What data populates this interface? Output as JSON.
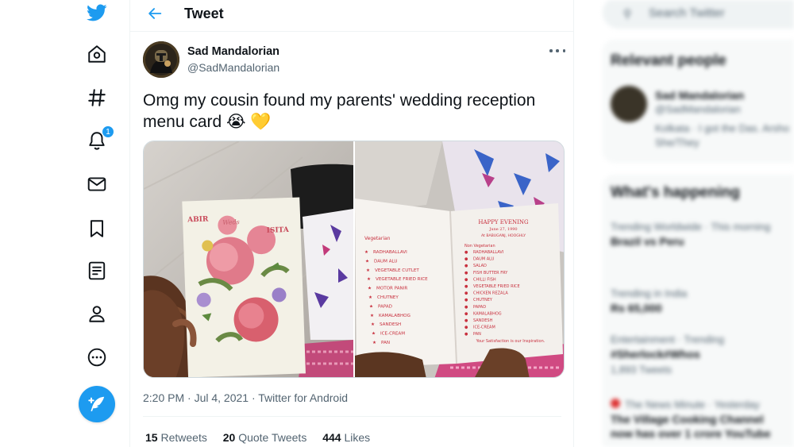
{
  "app": {
    "title": "Tweet",
    "brand_color": "#1d9bf0",
    "notification_count": "1"
  },
  "nav": {
    "items": [
      {
        "icon": "twitter-logo-icon"
      },
      {
        "icon": "home-icon"
      },
      {
        "icon": "explore-hashtag-icon"
      },
      {
        "icon": "notifications-bell-icon",
        "badge": "1"
      },
      {
        "icon": "messages-envelope-icon"
      },
      {
        "icon": "bookmarks-icon"
      },
      {
        "icon": "lists-icon"
      },
      {
        "icon": "profile-icon"
      },
      {
        "icon": "more-circle-icon"
      }
    ],
    "compose_icon": "compose-feather-icon"
  },
  "tweet": {
    "author_name": "Sad Mandalorian",
    "author_handle": "@SadMandalorian",
    "text": "Omg my cousin found my parents' wedding reception menu card 😭 💛",
    "meta": "2:20 PM · Jul 4, 2021 · Twitter for Android",
    "stats": {
      "retweets_count": "15",
      "retweets_label": "Retweets",
      "quotes_count": "20",
      "quotes_label": "Quote Tweets",
      "likes_count": "444",
      "likes_label": "Likes"
    },
    "card_front": {
      "name_left": "ABIR",
      "weds": "Weds",
      "name_right": "ISITA"
    },
    "card_inside": {
      "heading": "HAPPY EVENING",
      "date": "June 27, 1990",
      "place": "At BABUGANJ, HOOGHLY",
      "veg_title": "Vegetarian",
      "veg_items": [
        "RADHABALLAVI",
        "DAUM ALU",
        "VEGETABLE CUTLET",
        "VEGETABLE FRIED RICE",
        "MOTOR PANIR",
        "CHUTNEY",
        "PAPAD",
        "KAMALABHOG",
        "SANDESH",
        "ICE-CREAM",
        "PAN"
      ],
      "nonveg_title": "Non Vegetarian",
      "nonveg_items": [
        "RADHABALLAVI",
        "DAUM ALU",
        "SALAD",
        "FISH BUTTER FRY",
        "CHILLI FISH",
        "VEGETABLE FRIED RICE",
        "CHICKEN REZALA",
        "CHUTNEY",
        "PAPAD",
        "KAMALABHOG",
        "SANDESH",
        "ICE-CREAM",
        "PAN"
      ],
      "footer": "Your Satisfaction is our Inspiration."
    }
  },
  "sidebar": {
    "search_placeholder": "Search Twitter",
    "relevant_title": "Relevant people",
    "relevant_name": "Sad Mandalorian",
    "relevant_handle": "@SadMandalorian",
    "relevant_bio_1": "Kolkata · I got the Das. Arsho",
    "relevant_bio_2": "She/They",
    "happening_title": "What's happening",
    "trends": [
      {
        "context": "Trending Worldwide · This morning",
        "topic": "Brazil vs Peru"
      },
      {
        "context": "Trending in India",
        "topic": "Rs 65,000"
      },
      {
        "context": "Entertainment · Trending",
        "topic": "#Sherlock#Whos",
        "count": "1,893 Tweets"
      },
      {
        "context": "The News Minute · Yesterday",
        "topic": "The Village Cooking Channel"
      },
      {
        "context": "",
        "topic": "now has over 1 crore YouTube"
      }
    ]
  }
}
